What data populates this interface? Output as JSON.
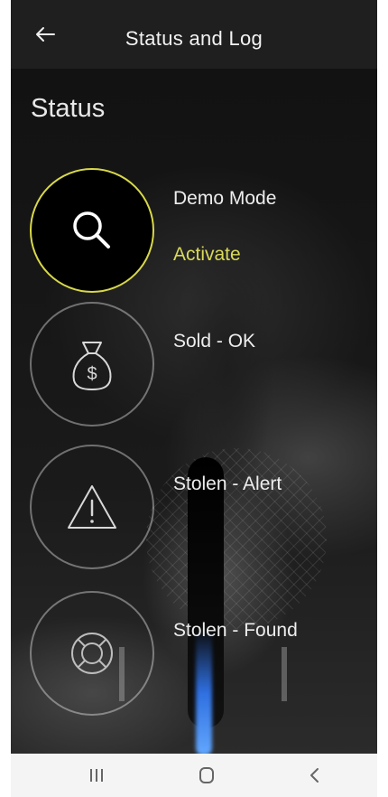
{
  "header": {
    "title": "Status and Log",
    "back_icon": "arrow-left-icon"
  },
  "status_section": {
    "title": "Status",
    "items": [
      {
        "label": "Demo Mode",
        "action": "Activate",
        "icon": "search-icon",
        "active": true
      },
      {
        "label": "Sold - OK",
        "icon": "money-bag-icon",
        "active": false
      },
      {
        "label": "Stolen - Alert",
        "icon": "warning-icon",
        "active": false
      },
      {
        "label": "Stolen - Found",
        "icon": "lifebuoy-icon",
        "active": false
      }
    ]
  },
  "colors": {
    "accent": "#d9d95a",
    "header_bg": "#1f1f1f",
    "navbar_bg": "#f4f4f4"
  },
  "system_nav": {
    "icons": [
      "recents-icon",
      "home-icon",
      "back-icon"
    ]
  }
}
